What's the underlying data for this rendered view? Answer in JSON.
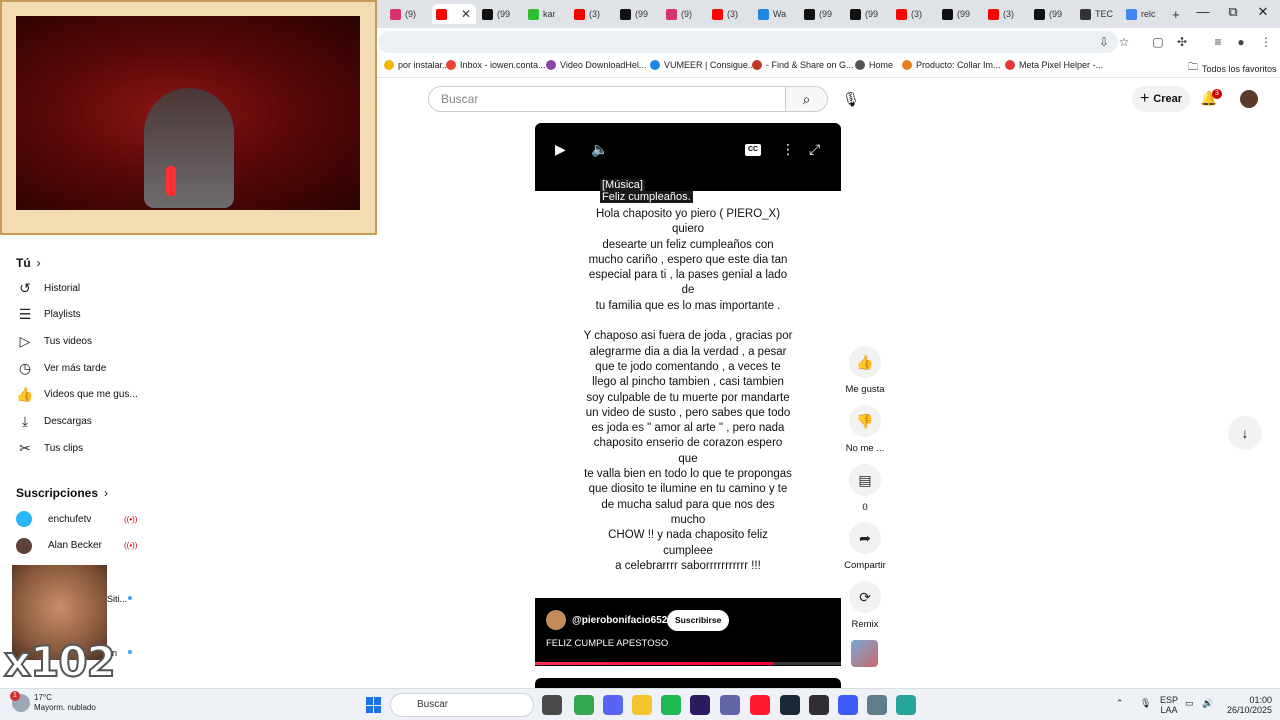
{
  "browser": {
    "tabs": [
      {
        "label": "(9)",
        "color": "#d6336c"
      },
      {
        "label": "",
        "color": "#ff0000",
        "active": true
      },
      {
        "label": "(99",
        "color": "#111111"
      },
      {
        "label": "kar",
        "color": "#2fbf2f"
      },
      {
        "label": "(3)",
        "color": "#ff0000"
      },
      {
        "label": "(99",
        "color": "#111111"
      },
      {
        "label": "(9)",
        "color": "#d6336c"
      },
      {
        "label": "(3)",
        "color": "#ff0000"
      },
      {
        "label": "Wa",
        "color": "#1e88e5"
      },
      {
        "label": "(99",
        "color": "#111111"
      },
      {
        "label": "(99",
        "color": "#111111"
      },
      {
        "label": "(3)",
        "color": "#ff0000"
      },
      {
        "label": "(99",
        "color": "#111111"
      },
      {
        "label": "(3)",
        "color": "#ff0000"
      },
      {
        "label": "(99",
        "color": "#111111"
      },
      {
        "label": "TEC",
        "color": "#333333"
      },
      {
        "label": "relc",
        "color": "#4285f4"
      }
    ],
    "new_tab": "+",
    "window_controls": {
      "minimize": "—",
      "maximize": "⧉",
      "close": "✕"
    },
    "bookmarks": [
      {
        "label": "por instalar...",
        "color": "#f4b400"
      },
      {
        "label": "Inbox - iowen.conta...",
        "color": "#ea4335"
      },
      {
        "label": "Video DownloadHel...",
        "color": "#8e44ad"
      },
      {
        "label": "VUMEER | Consigue...",
        "color": "#1e88e5"
      },
      {
        "label": "- Find & Share on G...",
        "color": "#c0392b"
      },
      {
        "label": "Home",
        "color": "#555555"
      },
      {
        "label": "Producto: Collar Im...",
        "color": "#e67e22"
      },
      {
        "label": "Meta Pixel Helper -...",
        "color": "#e53935"
      }
    ],
    "all_bookmarks": "Todos los favoritos"
  },
  "youtube": {
    "search_placeholder": "Buscar",
    "create_label": "Crear",
    "notification_count": "3"
  },
  "sidebar": {
    "you_title": "Tú",
    "items": [
      {
        "label": "Historial",
        "icon": "history-icon",
        "glyph": "↺"
      },
      {
        "label": "Playlists",
        "icon": "playlist-icon",
        "glyph": "☰"
      },
      {
        "label": "Tus videos",
        "icon": "video-icon",
        "glyph": "▷"
      },
      {
        "label": "Ver más tarde",
        "icon": "clock-icon",
        "glyph": "◷"
      },
      {
        "label": "Videos que me gus...",
        "icon": "thumb-up-icon",
        "glyph": "👍"
      },
      {
        "label": "Descargas",
        "icon": "download-icon",
        "glyph": "⤓"
      },
      {
        "label": "Tus clips",
        "icon": "scissors-icon",
        "glyph": "✂"
      }
    ],
    "subs_title": "Suscripciones",
    "subscriptions": [
      {
        "label": "enchufetv",
        "color": "#29b6f6",
        "live": true
      },
      {
        "label": "Alan Becker",
        "color": "#5d4037",
        "live": true
      }
    ],
    "partial_labels": [
      "Siti...",
      "ón"
    ]
  },
  "meme_overlay": {
    "text": "x102"
  },
  "player": {
    "caption_line_1": "[Música]",
    "caption_line_2": "Feliz cumpleaños.",
    "lyrics": "Hola chaposito yo piero ( PIERO_X)\nquiero\ndesearte un feliz cumpleaños con\nmucho cariño , espero que este dia tan\nespecial para ti , la pases genial a lado\nde\ntu familia que es lo mas importante .\n\nY chaposo asi fuera de joda  , gracias por\nalegrarme dia a dia la verdad ,  a pesar\nque te jodo comentando , a veces te\nllego al pincho tambien , casi tambien\nsoy culpable de tu muerte por mandarte\nun video de susto , pero sabes que todo\nes joda es \" amor al arte \" , pero nada\nchaposito enserio de corazon espero\nque\nte valla bien en todo lo que te propongas\nque diosito te ilumine en tu camino y te\nde mucha salud para que nos des\nmucho\nCHOW !! y nada chaposito feliz\ncumpleee\na celebrarrrr saborrrrrrrrrrr !!!",
    "cc_label": "CC",
    "channel_handle": "@pierobonifacio6529",
    "subscribe_label": "Suscribirse",
    "video_title": "FELIZ CUMPLE APESTOSO",
    "progress": 0.78
  },
  "actions": {
    "like_label": "Me gusta",
    "dislike_label": "No me ...",
    "comments_count": "0",
    "share_label": "Compartir",
    "remix_label": "Remix"
  },
  "taskbar": {
    "weather_temp": "17°C",
    "weather_desc": "Mayorm. nublado",
    "weather_badge": "1",
    "search_placeholder": "Buscar",
    "language_1": "ESP",
    "language_2": "LAA",
    "time": "01:00",
    "date": "26/10/2025",
    "apps": [
      {
        "name": "explorer-app-icon",
        "color": "#4a4a4a"
      },
      {
        "name": "chrome-app-icon",
        "color": "#34a853"
      },
      {
        "name": "discord-app-icon",
        "color": "#5865f2"
      },
      {
        "name": "folder-app-icon",
        "color": "#f4c430"
      },
      {
        "name": "spotify-app-icon",
        "color": "#1db954"
      },
      {
        "name": "premiere-app-icon",
        "color": "#2a1a5e"
      },
      {
        "name": "teams-app-icon",
        "color": "#6264a7"
      },
      {
        "name": "opera-app-icon",
        "color": "#ff1b2d"
      },
      {
        "name": "steam-app-icon",
        "color": "#1b2838"
      },
      {
        "name": "obs-app-icon",
        "color": "#302e31"
      },
      {
        "name": "vpn-app-icon",
        "color": "#3d5afe"
      },
      {
        "name": "settings-app-icon",
        "color": "#607d8b"
      },
      {
        "name": "tool-app-icon",
        "color": "#26a69a"
      }
    ]
  }
}
